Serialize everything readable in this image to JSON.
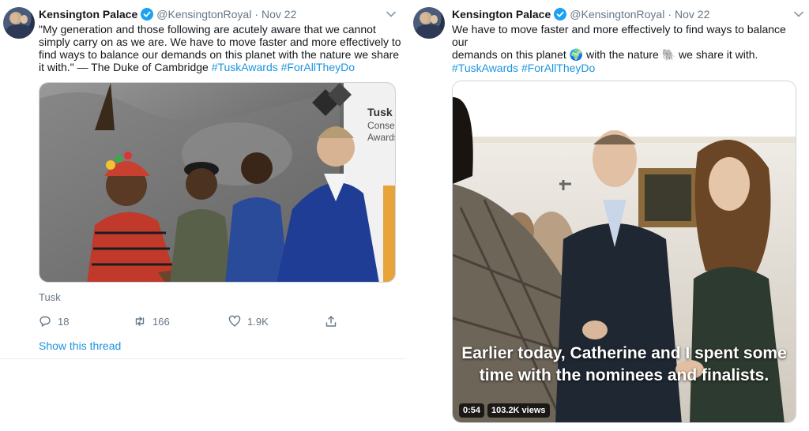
{
  "left_tweet": {
    "display_name": "Kensington Palace",
    "handle": "@KensingtonRoyal",
    "separator": "·",
    "date": "Nov 22",
    "text_lines": [
      "\"My generation and those following are acutely aware that we cannot",
      "simply carry on as we are. We have to move faster and more effectively to",
      "find ways to balance our demands on this planet with the nature we share"
    ],
    "text_last_plain": "it with.\" — The Duke of Cambridge ",
    "hashtag_1": "#TuskAwards",
    "hashtag_2": "#ForAllTheyDo",
    "image_sign_line1": "Tusk",
    "image_sign_line2": "Conserva",
    "image_sign_line3": "Awards",
    "source": "Tusk",
    "replies": "18",
    "retweets": "166",
    "likes": "1.9K",
    "show_thread": "Show this thread"
  },
  "right_tweet": {
    "display_name": "Kensington Palace",
    "handle": "@KensingtonRoyal",
    "separator": "·",
    "date": "Nov 22",
    "text_line1": "We have to move faster and more effectively to find ways to balance our",
    "text_line2_a": "demands on this planet",
    "globe_emoji": "🌍",
    "text_line2_b": "with the nature",
    "elephant_emoji": "🐘",
    "text_line2_c": "we share it with.",
    "hashtag_1": "#TuskAwards",
    "hashtag_2": "#ForAllTheyDo",
    "video_caption_line1": "Earlier today, Catherine and I spent some",
    "video_caption_line2": "time with the nominees and finalists.",
    "video_duration": "0:54",
    "video_views": "103.2K views"
  },
  "colors": {
    "link": "#1b95e0",
    "verified": "#1da1f2",
    "secondary_text": "#657786"
  }
}
